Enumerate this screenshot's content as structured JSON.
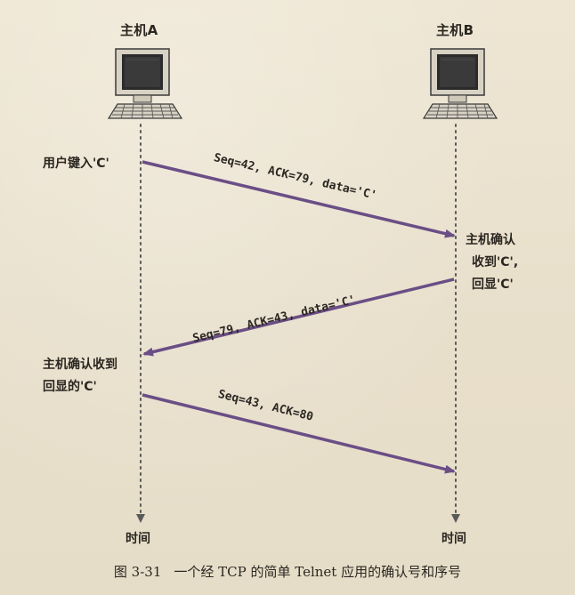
{
  "diagram": {
    "host_a": {
      "label": "主机A",
      "icon": "computer-icon"
    },
    "host_b": {
      "label": "主机B",
      "icon": "computer-icon"
    },
    "messages": [
      {
        "text": "Seq=42, ACK=79, data='C'",
        "from": "A",
        "to": "B"
      },
      {
        "text": "Seq=79, ACK=43, data='C'",
        "from": "B",
        "to": "A"
      },
      {
        "text": "Seq=43, ACK=80",
        "from": "A",
        "to": "B"
      }
    ],
    "notes": {
      "user_types_line": "用户键入'C'",
      "host_b_ack_line1": "主机确认",
      "host_b_ack_line2": "收到'C',",
      "host_b_ack_line3": "回显'C'",
      "host_a_ack_line1": "主机确认收到",
      "host_a_ack_line2": "回显的'C'"
    },
    "time_label_a": "时间",
    "time_label_b": "时间",
    "caption_number": "图 3-31",
    "caption_text": "一个经 TCP 的简单 Telnet 应用的确认号和序号",
    "colors": {
      "arrow": "#6a4e86",
      "lifeline": "#5a5a5a"
    }
  }
}
